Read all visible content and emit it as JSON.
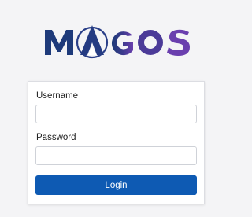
{
  "brand": {
    "logo_text": "MAGOS",
    "logo_icon": "magos-logo-icon",
    "colors": {
      "navy": "#1b2a63",
      "purple": "#5a3a9a",
      "purple_light": "#6e4db0"
    }
  },
  "login_form": {
    "username_label": "Username",
    "username_value": "",
    "password_label": "Password",
    "password_value": "",
    "login_button_label": "Login",
    "button_color": "#0e5ab3"
  }
}
